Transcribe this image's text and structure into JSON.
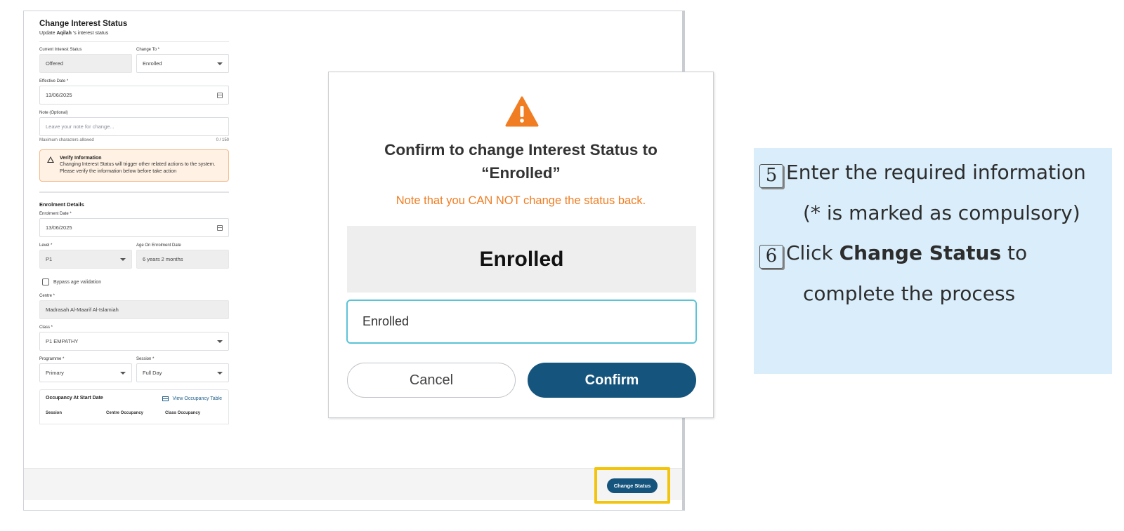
{
  "form": {
    "title": "Change Interest Status",
    "subtitle_pre": "Update ",
    "subtitle_name": "Aqilah",
    "subtitle_post": " 's interest status",
    "current_status_label": "Current Interest Status",
    "current_status_value": "Offered",
    "change_to_label": "Change To *",
    "change_to_value": "Enrolled",
    "effective_date_label": "Effective Date *",
    "effective_date_value": "13/06/2025",
    "note_label": "Note (Optional)",
    "note_placeholder": "Leave your note for change...",
    "note_hint": "Maximum characters allowed",
    "note_count": "0 / 150",
    "verify_title": "Verify Information",
    "verify_text": "Changing Interest Status will trigger other related actions to the system. Please verify the information below before take action",
    "enrolment_section": "Enrolment Details",
    "enrolment_date_label": "Enrolment Date *",
    "enrolment_date_value": "13/06/2025",
    "level_label": "Level *",
    "level_value": "P1",
    "age_label": "Age On Enrolment Date",
    "age_value": "6 years 2 months",
    "bypass_label": "Bypass age validation",
    "centre_label": "Centre *",
    "centre_value": "Madrasah Al-Maarif Al-Islamiah",
    "class_label": "Class *",
    "class_value": "P1 EMPATHY",
    "programme_label": "Programme *",
    "programme_value": "Primary",
    "session_label": "Session *",
    "session_value": "Full Day",
    "occupancy_title": "Occupancy At Start Date",
    "occupancy_link": "View Occupancy Table",
    "col_session": "Session",
    "col_centre": "Centre Occupancy",
    "col_class": "Class Occupancy",
    "change_status_button": "Change Status"
  },
  "modal": {
    "title_line1": "Confirm to change Interest Status to",
    "title_line2": "“Enrolled”",
    "note": "Note that you CAN NOT change the status back.",
    "status_display": "Enrolled",
    "input_value": "Enrolled",
    "cancel": "Cancel",
    "confirm": "Confirm",
    "warning_color": "#f07d22"
  },
  "guide": {
    "step5_num": "5",
    "step5_text": "Enter the required information",
    "step5_sub": "(* is marked as compulsory)",
    "step6_num": "6",
    "step6_pre": "Click ",
    "step6_bold": "Change Status",
    "step6_post": " to",
    "step6_sub": "complete the process"
  },
  "colors": {
    "primary": "#15547c",
    "highlight": "#f2c40c",
    "guide_bg": "#d9edfa"
  }
}
